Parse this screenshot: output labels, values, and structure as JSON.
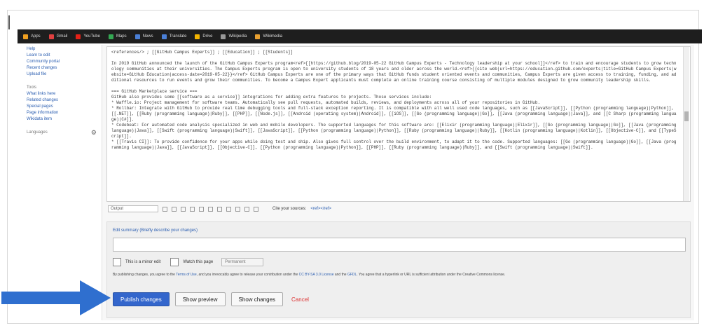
{
  "bookmarks": [
    {
      "label": "Apps",
      "color": "#f0a020"
    },
    {
      "label": "Gmail",
      "color": "#e04040"
    },
    {
      "label": "YouTube",
      "color": "#e62117"
    },
    {
      "label": "Maps",
      "color": "#34a853"
    },
    {
      "label": "News",
      "color": "#4a7fd6"
    },
    {
      "label": "Translate",
      "color": "#4a7fd6"
    },
    {
      "label": "Drive",
      "color": "#f4b400"
    },
    {
      "label": "Wikipedia",
      "color": "#999999"
    },
    {
      "label": "Wikimedia",
      "color": "#e8a030"
    }
  ],
  "sidebar": {
    "items": [
      "Help",
      "Learn to edit",
      "Community portal",
      "Recent changes",
      "Upload file"
    ],
    "tools_heading": "Tools",
    "tools": [
      "What links here",
      "Related changes",
      "Special pages",
      "Page information",
      "Wikidata item"
    ],
    "languages_label": "Languages"
  },
  "editor": {
    "text": "<references/> ; [[GitHub Campus Experts]] ; [[Education]] ; [[Students]]\n\nIn 2019 GitHub announced the launch of the GitHub Campus Experts program<ref>[[https://github.blog/2019-05-22 GitHub Campus Experts - Technology leadership at your school]]</ref> to train and encourage students to grow technology communities at their universities. The Campus Experts program is open to university students of 18 years and older across the world.<ref>{{cite web|url=https://education.github.com/experts|title=GitHub Campus Experts|website=GitHub Education|access-date=2019-05-22}}</ref> GitHub Campus Experts are one of the primary ways that GitHub funds student oriented events and communities, Campus Experts are given access to training, funding, and additional resources to run events and grow their communities. To become a Campus Expert applicants must complete an online training course consisting of multiple modules designed to grow community leadership skills.\n\n=== GitHub Marketplace service ===\nGitHub also provides some [[software as a service]] integrations for adding extra features to projects. Those services include:\n* Waffle.io: Project management for software teams. Automatically see pull requests, automated builds, reviews, and deployments across all of your repositories in GitHub.\n* Rollbar: Integrate with GitHub to provide real time debugging tools and full-stack exception reporting. It is compatible with all well used code languages, such as [[JavaScript]], [[Python (programming language)|Python]], [[.NET]], [[Ruby (programming language)|Ruby]], [[PHP]], [[Node.js]], [[Android (operating system)|Android]], [[iOS]], [[Go (programming language)|Go]], [[Java (programming language)|Java]], and [[C Sharp (programming language)|C#]].\n* Codebeat: For automated code analysis specialized in web and mobile developers. The supported languages for this software are: [[Elixir (programming language)|Elixir]], [[Go (programming language)|Go]], [[Java (programming language)|Java]], [[Swift (programming language)|Swift]], [[JavaScript]], [[Python (programming language)|Python]], [[Ruby (programming language)|Ruby]], [[Kotlin (programming language)|Kotlin]], [[Objective-C]], and [[TypeScript]].\n* [[Travis CI]]: To provide confidence for your apps while doing test and ship. Also gives full control over the build environment, to adapt it to the code. Supported languages: [[Go (programming language)|Go]], [[Java (programming language)|Java]], [[JavaScript]], [[Objective-C]], [[Python (programming language)|Python]], [[PHP]], [[Ruby (programming language)|Ruby]], and [[Swift (programming language)|Swift]]."
  },
  "toolbar": {
    "format_select": "Output",
    "cite_label": "Cite your sources:",
    "cite_link": "<ref></ref>"
  },
  "summary": {
    "label": "Edit summary (Briefly describe your changes)",
    "minor_label": "This is a minor edit",
    "watch_label": "Watch this page",
    "watch_select": "Permanent",
    "legal_prefix": "By publishing changes, you agree to the ",
    "legal_terms": "Terms of Use",
    "legal_mid": ", and you irrevocably agree to release your contribution under the ",
    "legal_license": "CC BY-SA 3.0 License",
    "legal_and": " and the ",
    "legal_gfdl": "GFDL",
    "legal_suffix": ". You agree that a hyperlink or URL is sufficient attribution under the Creative Commons license."
  },
  "actions": {
    "publish": "Publish changes",
    "preview": "Show preview",
    "changes": "Show changes",
    "cancel": "Cancel"
  },
  "colors": {
    "primary": "#3366cc",
    "arrow": "#2f6fcf",
    "cancel": "#dd3333"
  }
}
